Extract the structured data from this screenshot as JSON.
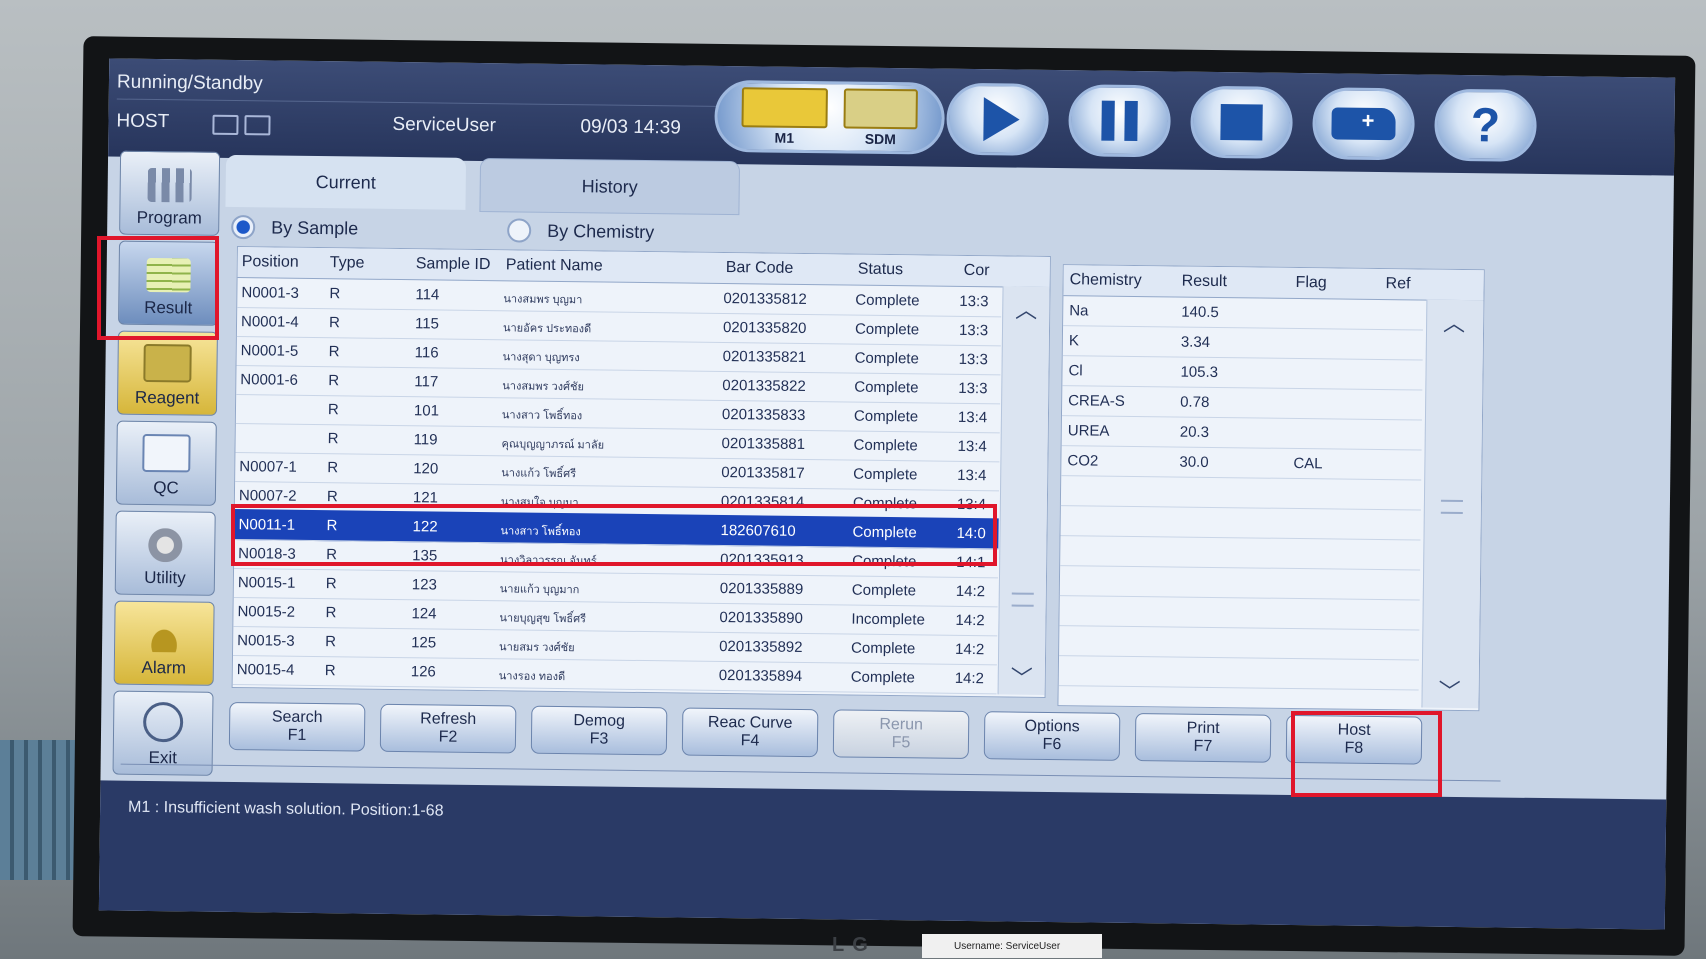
{
  "header": {
    "status": "Running/Standby",
    "host_label": "HOST",
    "user": "ServiceUser",
    "datetime": "09/03 14:39"
  },
  "toolbar": {
    "m1_label": "M1",
    "sdm_label": "SDM",
    "icons": [
      "play-icon",
      "pause-icon",
      "stop-icon",
      "ambulance-icon",
      "help-icon"
    ]
  },
  "sidebar": {
    "items": [
      {
        "label": "Program"
      },
      {
        "label": "Result"
      },
      {
        "label": "Reagent"
      },
      {
        "label": "QC"
      },
      {
        "label": "Utility"
      },
      {
        "label": "Alarm"
      },
      {
        "label": "Exit"
      }
    ]
  },
  "tabs": {
    "current": "Current",
    "history": "History"
  },
  "view": {
    "by_sample": "By Sample",
    "by_chemistry": "By Chemistry"
  },
  "samples": {
    "columns": [
      "Position",
      "Type",
      "Sample ID",
      "Patient Name",
      "Bar Code",
      "Status",
      "Cor"
    ],
    "rows": [
      {
        "position": "N0001-3",
        "type": "R",
        "sample_id": "114",
        "patient": "นางสมพร บุญมา",
        "barcode": "0201335812",
        "status": "Complete",
        "time": "13:3"
      },
      {
        "position": "N0001-4",
        "type": "R",
        "sample_id": "115",
        "patient": "นายอัคร ประทองดี",
        "barcode": "0201335820",
        "status": "Complete",
        "time": "13:3"
      },
      {
        "position": "N0001-5",
        "type": "R",
        "sample_id": "116",
        "patient": "นางสุดา บุญทรง",
        "barcode": "0201335821",
        "status": "Complete",
        "time": "13:3"
      },
      {
        "position": "N0001-6",
        "type": "R",
        "sample_id": "117",
        "patient": "นางสมพร วงศ์ชัย",
        "barcode": "0201335822",
        "status": "Complete",
        "time": "13:3"
      },
      {
        "position": "",
        "type": "R",
        "sample_id": "101",
        "patient": "นางสาว โพธิ์ทอง",
        "barcode": "0201335833",
        "status": "Complete",
        "time": "13:4"
      },
      {
        "position": "",
        "type": "R",
        "sample_id": "119",
        "patient": "คุณบุญญาภรณ์ มาลัย",
        "barcode": "0201335881",
        "status": "Complete",
        "time": "13:4"
      },
      {
        "position": "N0007-1",
        "type": "R",
        "sample_id": "120",
        "patient": "นางแก้ว โพธิ์ศรี",
        "barcode": "0201335817",
        "status": "Complete",
        "time": "13:4"
      },
      {
        "position": "N0007-2",
        "type": "R",
        "sample_id": "121",
        "patient": "นางสมใจ บุญมา",
        "barcode": "0201335814",
        "status": "Complete",
        "time": "13:4"
      },
      {
        "position": "N0011-1",
        "type": "R",
        "sample_id": "122",
        "patient": "นางสาว โพธิ์ทอง",
        "barcode": "182607610",
        "status": "Complete",
        "time": "14:0",
        "selected": true
      },
      {
        "position": "N0018-3",
        "type": "R",
        "sample_id": "135",
        "patient": "นางวิลาวรรณ จันทร์",
        "barcode": "0201335913",
        "status": "Complete",
        "time": "14:1"
      },
      {
        "position": "N0015-1",
        "type": "R",
        "sample_id": "123",
        "patient": "นายแก้ว บุญมาก",
        "barcode": "0201335889",
        "status": "Complete",
        "time": "14:2"
      },
      {
        "position": "N0015-2",
        "type": "R",
        "sample_id": "124",
        "patient": "นายบุญสุข โพธิ์ศรี",
        "barcode": "0201335890",
        "status": "Incomplete",
        "time": "14:2"
      },
      {
        "position": "N0015-3",
        "type": "R",
        "sample_id": "125",
        "patient": "นายสมร วงศ์ชัย",
        "barcode": "0201335892",
        "status": "Complete",
        "time": "14:2"
      },
      {
        "position": "N0015-4",
        "type": "R",
        "sample_id": "126",
        "patient": "นางรอง ทองดี",
        "barcode": "0201335894",
        "status": "Complete",
        "time": "14:2"
      }
    ]
  },
  "results": {
    "columns": [
      "Chemistry",
      "Result",
      "Flag",
      "Ref"
    ],
    "rows": [
      {
        "chemistry": "Na",
        "result": "140.5",
        "flag": ""
      },
      {
        "chemistry": "K",
        "result": "3.34",
        "flag": ""
      },
      {
        "chemistry": "Cl",
        "result": "105.3",
        "flag": ""
      },
      {
        "chemistry": "CREA-S",
        "result": "0.78",
        "flag": ""
      },
      {
        "chemistry": "UREA",
        "result": "20.3",
        "flag": ""
      },
      {
        "chemistry": "CO2",
        "result": "30.0",
        "flag": "CAL"
      }
    ]
  },
  "function_keys": [
    {
      "label": "Search",
      "key": "F1"
    },
    {
      "label": "Refresh",
      "key": "F2"
    },
    {
      "label": "Demog",
      "key": "F3"
    },
    {
      "label": "Reac Curve",
      "key": "F4"
    },
    {
      "label": "Rerun",
      "key": "F5"
    },
    {
      "label": "Options",
      "key": "F6"
    },
    {
      "label": "Print",
      "key": "F7"
    },
    {
      "label": "Host",
      "key": "F8"
    }
  ],
  "message": "M1 : Insufficient wash solution.  Position:1-68",
  "monitor": {
    "brand": "LG",
    "sticker": "Username: ServiceUser"
  },
  "colors": {
    "highlight": "#e0162b",
    "selected_row": "#1a43b8",
    "header_bg": "#2f3e68"
  }
}
